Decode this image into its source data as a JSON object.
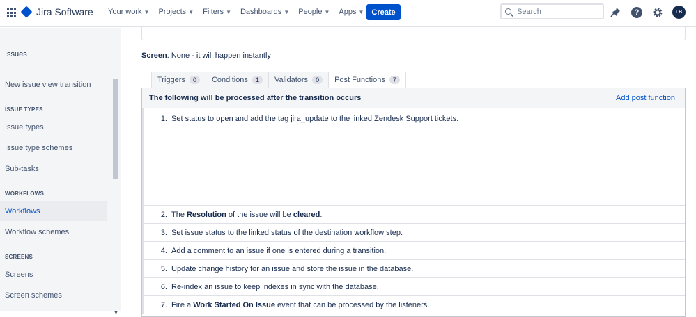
{
  "header": {
    "app_name": "Jira Software",
    "nav": [
      "Your work",
      "Projects",
      "Filters",
      "Dashboards",
      "People",
      "Apps"
    ],
    "create_label": "Create",
    "search_placeholder": "Search",
    "help_label": "?",
    "avatar_initials": "LB"
  },
  "sidebar": {
    "title": "Issues",
    "transition_item": "New issue view transition",
    "sections": [
      {
        "heading": "ISSUE TYPES",
        "items": [
          "Issue types",
          "Issue type schemes",
          "Sub-tasks"
        ]
      },
      {
        "heading": "WORKFLOWS",
        "items": [
          "Workflows",
          "Workflow schemes"
        ]
      },
      {
        "heading": "SCREENS",
        "items": [
          "Screens",
          "Screen schemes"
        ]
      }
    ],
    "active_item": "Workflows"
  },
  "main": {
    "screen_label": "Screen",
    "screen_value": ": None - it will happen instantly",
    "tabs": [
      {
        "label": "Triggers",
        "count": "0"
      },
      {
        "label": "Conditions",
        "count": "1"
      },
      {
        "label": "Validators",
        "count": "0"
      },
      {
        "label": "Post Functions",
        "count": "7"
      }
    ],
    "post_functions": {
      "title": "The following will be processed after the transition occurs",
      "add_label": "Add post function",
      "items": [
        {
          "num": "1.",
          "pre": "Set status to open and add the tag jira_update to the linked Zendesk Support tickets.",
          "bold": "",
          "mid": "",
          "bold2": "",
          "post": ""
        },
        {
          "num": "2.",
          "pre": "The ",
          "bold": "Resolution",
          "mid": " of the issue will be ",
          "bold2": "cleared",
          "post": "."
        },
        {
          "num": "3.",
          "pre": "Set issue status to the linked status of the destination workflow step.",
          "bold": "",
          "mid": "",
          "bold2": "",
          "post": ""
        },
        {
          "num": "4.",
          "pre": "Add a comment to an issue if one is entered during a transition.",
          "bold": "",
          "mid": "",
          "bold2": "",
          "post": ""
        },
        {
          "num": "5.",
          "pre": "Update change history for an issue and store the issue in the database.",
          "bold": "",
          "mid": "",
          "bold2": "",
          "post": ""
        },
        {
          "num": "6.",
          "pre": "Re-index an issue to keep indexes in sync with the database.",
          "bold": "",
          "mid": "",
          "bold2": "",
          "post": ""
        },
        {
          "num": "7.",
          "pre": "Fire a ",
          "bold": "Work Started On Issue",
          "mid": " event that can be processed by the listeners.",
          "bold2": "",
          "post": ""
        }
      ]
    }
  },
  "colors": {
    "brand": "#0052cc",
    "sidebar_bg": "#f4f5f7"
  },
  "icons": [
    "app-switcher-icon",
    "jira-logo-icon",
    "notifications-icon",
    "help-icon",
    "settings-icon",
    "search-icon"
  ]
}
